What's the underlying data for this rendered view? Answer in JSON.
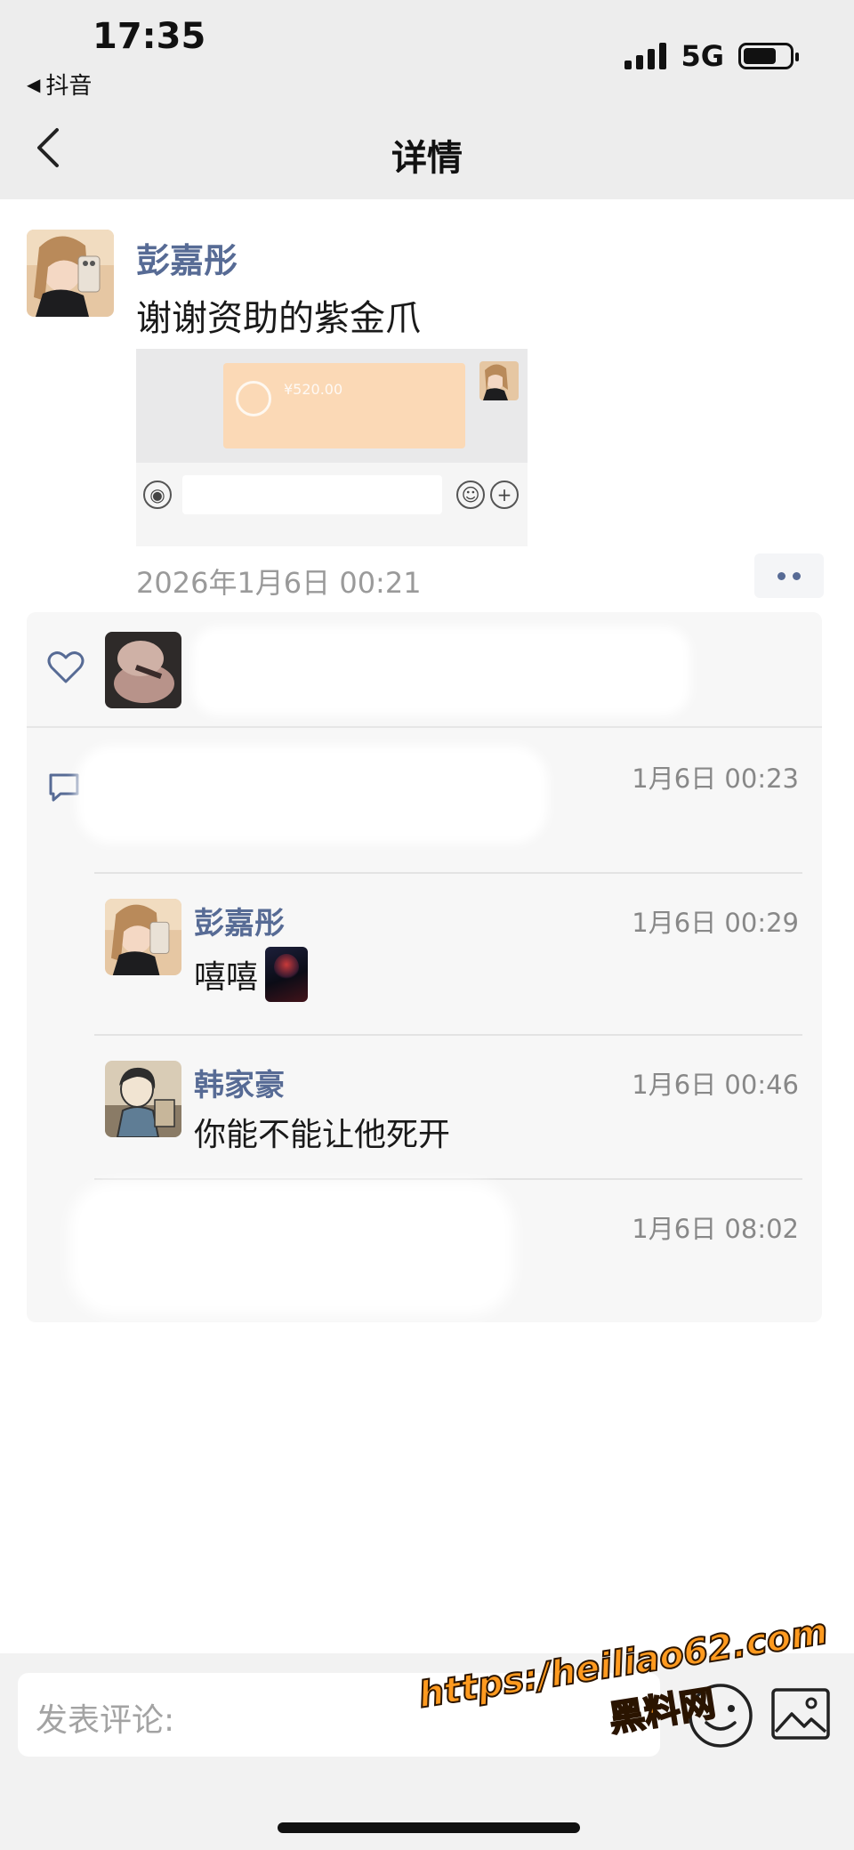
{
  "status_bar": {
    "time": "17:35",
    "back_app": "抖音",
    "network": "5G"
  },
  "nav": {
    "title": "详情"
  },
  "post": {
    "author": "彭嘉彤",
    "text": "谢谢资助的紫金爪",
    "date": "2026年1月6日 00:21",
    "image": {
      "amount": "¥520.00"
    }
  },
  "comments": [
    {
      "author": "",
      "text": "",
      "time": "1月6日 00:23"
    },
    {
      "author": "彭嘉彤",
      "text": "嘻嘻",
      "time": "1月6日 00:29"
    },
    {
      "author": "韩家豪",
      "text": "你能不能让他死开",
      "time": "1月6日 00:46"
    },
    {
      "author": "",
      "text": "",
      "time": "1月6日 08:02"
    }
  ],
  "composer": {
    "placeholder": "发表评论:"
  },
  "watermark": {
    "url": "https:/heiliao62.com",
    "name": "黑料网"
  },
  "colors": {
    "name_blue": "#576b95",
    "header_bg": "#ededed",
    "comment_bg": "#f7f7f7",
    "watermark": "#ff9a1f"
  }
}
